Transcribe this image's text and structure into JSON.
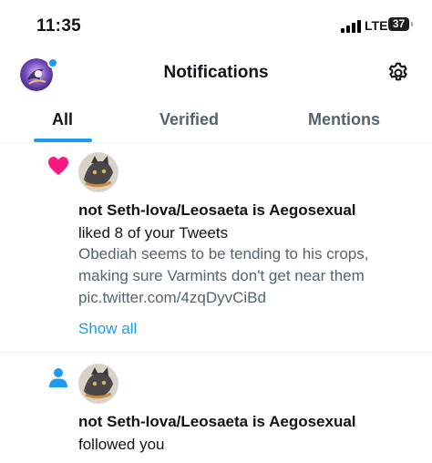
{
  "status_bar": {
    "time": "11:35",
    "network": "LTE",
    "battery": "37"
  },
  "header": {
    "title": "Notifications",
    "avatar_icon": "profile-avatar-icon",
    "settings_icon": "gear-icon"
  },
  "tabs": [
    {
      "label": "All",
      "active": true
    },
    {
      "label": "Verified",
      "active": false
    },
    {
      "label": "Mentions",
      "active": false
    }
  ],
  "notifications": [
    {
      "type_icon": "heart-icon",
      "name": "not Seth-Iova/Leosaeta is Aegosexual",
      "action": "liked 8 of your Tweets",
      "body": "Obediah seems to be tending to his crops, making sure Varmints don't get near them pic.twitter.com/4zqDyvCiBd",
      "show_all": "Show all"
    },
    {
      "type_icon": "person-icon",
      "name": "not Seth-Iova/Leosaeta is Aegosexual",
      "action": "followed you"
    }
  ],
  "colors": {
    "accent": "#1d9bf0",
    "like": "#f91880",
    "secondary_text": "#536471"
  }
}
